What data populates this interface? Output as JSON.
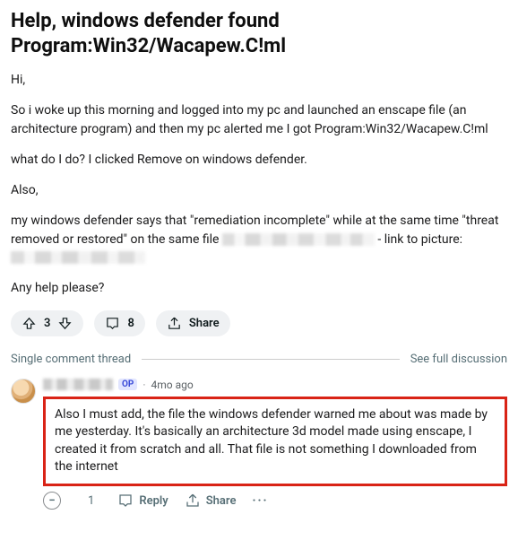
{
  "post": {
    "title": "Help, windows defender found Program:Win32/Wacapew.C!ml",
    "paragraphs": {
      "p1": "Hi,",
      "p2": "So i woke up this morning and logged into my pc and launched an enscape file (an architecture program) and then my pc alerted me I got Program:Win32/Wacapew.C!ml",
      "p3": "what do I do? I clicked Remove on windows defender.",
      "p4": "Also,",
      "p5a": "my windows defender says that \"remediation incomplete\" while at the same time \"threat removed or restored\" on the same file ",
      "p5b": " - link to picture: ",
      "p6": "Any help please?"
    }
  },
  "actions": {
    "vote_count": "3",
    "comment_count": "8",
    "share_label": "Share"
  },
  "thread": {
    "left_label": "Single comment thread",
    "right_label": "See full discussion"
  },
  "comment": {
    "op_badge": "OP",
    "meta_dot": "·",
    "time": "4mo ago",
    "text": "Also I must add, the file the windows defender warned me about was made by me yesterday. It's basically an architecture 3d model made using enscape, I created it from scratch and all. That file is not something I downloaded from the internet",
    "collapse": "−",
    "vote_count": "1",
    "reply_label": "Reply",
    "share_label": "Share",
    "more": "···"
  }
}
